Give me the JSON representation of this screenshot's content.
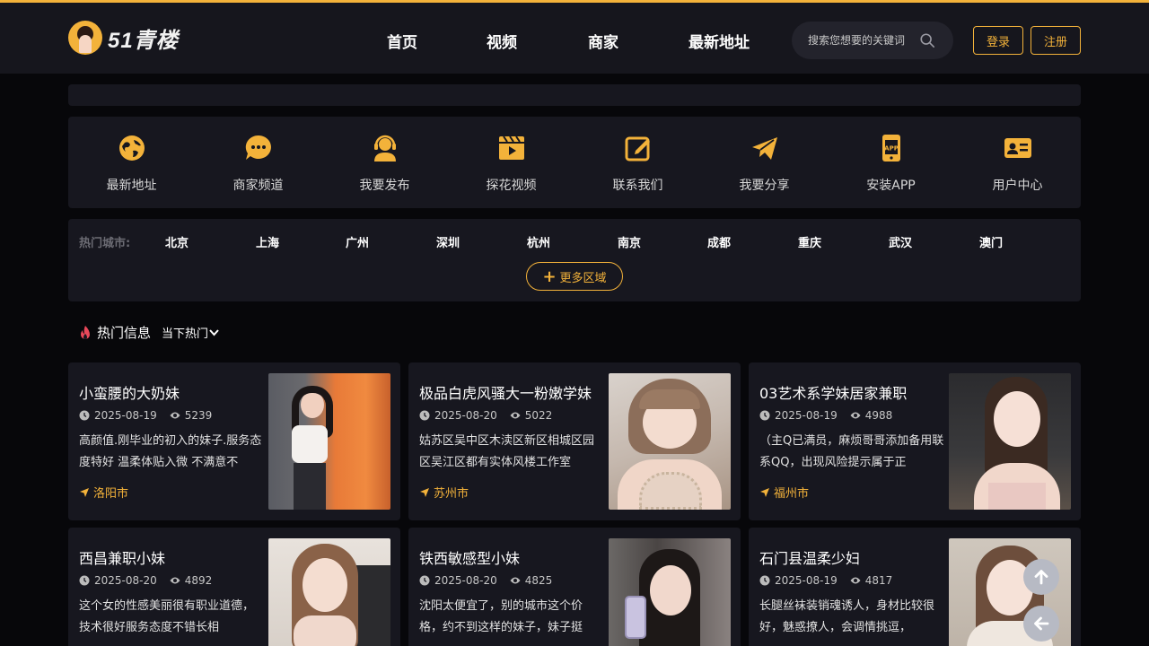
{
  "header": {
    "brand": "51青楼",
    "nav": [
      "首页",
      "视频",
      "商家",
      "最新地址"
    ],
    "search_placeholder": "搜索您想要的关键词",
    "login": "登录",
    "register": "注册",
    "accent": "#f3b23a"
  },
  "quick_links": [
    {
      "label": "最新地址",
      "icon": "globe-icon"
    },
    {
      "label": "商家频道",
      "icon": "chat-icon"
    },
    {
      "label": "我要发布",
      "icon": "headset-icon"
    },
    {
      "label": "探花视频",
      "icon": "video-icon"
    },
    {
      "label": "联系我们",
      "icon": "edit-icon"
    },
    {
      "label": "我要分享",
      "icon": "paper-plane-icon"
    },
    {
      "label": "安装APP",
      "icon": "app-icon"
    },
    {
      "label": "用户中心",
      "icon": "id-card-icon"
    }
  ],
  "cities": {
    "label": "热门城市:",
    "items": [
      "北京",
      "上海",
      "广州",
      "深圳",
      "杭州",
      "南京",
      "成都",
      "重庆",
      "武汉",
      "澳门"
    ],
    "more": "更多区域"
  },
  "hot": {
    "title": "热门信息",
    "sort": "当下热门"
  },
  "posts": [
    {
      "title": "小蛮腰的大奶妹",
      "date": "2025-08-19",
      "views": "5239",
      "desc": "高颜值.刚毕业的初入的妹子.服务态度特好 温柔体贴入微 不满意不",
      "city": "洛阳市"
    },
    {
      "title": "极品白虎风骚大一粉嫩学妹",
      "date": "2025-08-20",
      "views": "5022",
      "desc": "姑苏区吴中区木渎区新区相城区园区吴江区都有实体风楼工作室",
      "city": "苏州市"
    },
    {
      "title": "03艺术系学妹居家兼职",
      "date": "2025-08-19",
      "views": "4988",
      "desc": "（主Q已满员，麻烦哥哥添加备用联系QQ，出现风险提示属于正",
      "city": "福州市"
    },
    {
      "title": "西昌兼职小妹",
      "date": "2025-08-20",
      "views": "4892",
      "desc": "这个女的性感美丽很有职业道德，技术很好服务态度不错长相",
      "city": ""
    },
    {
      "title": "铁西敏感型小妹",
      "date": "2025-08-20",
      "views": "4825",
      "desc": "沈阳太便宜了，别的城市这个价格，约不到这样的妹子，妹子挺",
      "city": ""
    },
    {
      "title": "石门县温柔少妇",
      "date": "2025-08-19",
      "views": "4817",
      "desc": "长腿丝袜装销魂诱人，身材比较很好，魅惑撩人，会调情挑逗，",
      "city": ""
    }
  ]
}
